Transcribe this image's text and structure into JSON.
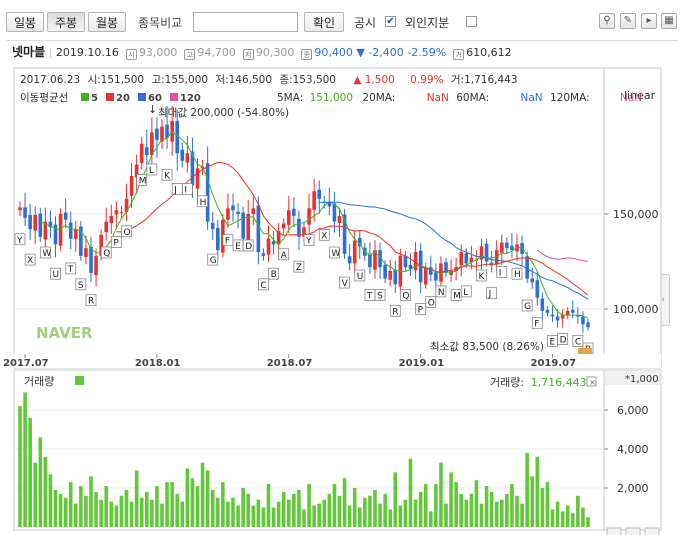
{
  "toolbar": {
    "daily": "일봉",
    "weekly": "주봉",
    "monthly": "월봉",
    "compare_label": "종목비교",
    "confirm": "확인",
    "disclosure": "공시",
    "foreign": "외인지분"
  },
  "header": {
    "name": "넷마블",
    "date": "2019.10.16",
    "open_icon": "시",
    "open": "93,000",
    "high_icon": "고",
    "high": "94,700",
    "low_icon": "저",
    "low": "90,300",
    "close_icon": "종",
    "close": "90,400",
    "change": "▼ -2,400",
    "rate": "-2.59%",
    "volume_icon": "거",
    "volume": "610,612"
  },
  "info_line": {
    "date": "2017.06.23",
    "open": "시:151,500",
    "high": "고:155,000",
    "low": "저:146,500",
    "close": "종:153,500",
    "change": "▲ 1,500",
    "rate": "0.99%",
    "volume": "거:1,716,443"
  },
  "ma_legend": {
    "title": "이동평균선",
    "items": [
      {
        "label": "5",
        "color": "#3cb521"
      },
      {
        "label": "20",
        "color": "#e8322d"
      },
      {
        "label": "60",
        "color": "#2c6fd6"
      },
      {
        "label": "120",
        "color": "#e44fa6"
      }
    ],
    "ma5_label": "5MA:",
    "ma5_value": "151,000",
    "ma20_label": "20MA:",
    "ma20_value": "NaN",
    "ma60_label": "60MA:",
    "ma60_value": "NaN",
    "ma120_label": "120MA:",
    "ma120_value": "NaN"
  },
  "scale_mode": "linear",
  "max_label": "최대값 200,000 (-54.80%)",
  "min_label": "최소값 83,500 (8.26%)",
  "watermark": "NAVER",
  "volume_panel": {
    "title": "거래량",
    "value_label": "거래량:",
    "value": "1,716,443",
    "unit": "*1,000"
  },
  "colors": {
    "up": "#e8322d",
    "down": "#2c6fd6",
    "volume": "#63c73a",
    "ma5": "#3cb521",
    "ma20": "#e8322d",
    "ma60": "#2c6fd6",
    "ma120": "#e44fa6"
  },
  "chart_data": [
    {
      "type": "candlestick",
      "x_ticks": [
        "2017.07",
        "2018.01",
        "2018.07",
        "2019.01",
        "2019.07"
      ],
      "y_ticks": [
        "150,000",
        "100,000"
      ],
      "ylim": [
        80000,
        220000
      ],
      "weekly_close": [
        153500,
        148000,
        142000,
        149500,
        138000,
        146000,
        143000,
        134000,
        150000,
        147000,
        137000,
        142000,
        128000,
        132000,
        119000,
        128000,
        139000,
        146000,
        149000,
        152000,
        151000,
        158000,
        170000,
        176000,
        187000,
        181000,
        193000,
        189000,
        196000,
        190000,
        199000,
        182000,
        178000,
        182000,
        165000,
        174000,
        175000,
        146000,
        142000,
        131000,
        147000,
        153000,
        152000,
        150000,
        137000,
        150000,
        153000,
        130000,
        128000,
        137000,
        134000,
        141000,
        145000,
        152000,
        149000,
        138000,
        143000,
        153000,
        162000,
        158000,
        156000,
        154000,
        146000,
        149000,
        129000,
        124000,
        136000,
        133000,
        128000,
        122000,
        131000,
        122000,
        116000,
        120000,
        113000,
        128000,
        122000,
        121000,
        130000,
        114000,
        122000,
        118000,
        115000,
        124000,
        119000,
        120000,
        122000,
        130000,
        124000,
        127000,
        126000,
        133000,
        125000,
        123000,
        131000,
        135000,
        132000,
        131000,
        134000,
        129000,
        116000,
        114000,
        106000,
        99000,
        98000,
        96000,
        94000,
        97000,
        99000,
        98000,
        96000,
        92000,
        90400
      ],
      "ma20": [
        null,
        null,
        null,
        null,
        null,
        null,
        null,
        null,
        null,
        null,
        null,
        null,
        null,
        null,
        null,
        null,
        null,
        null,
        null,
        140700,
        140600,
        141100,
        142500,
        143800,
        145700,
        147500,
        150400,
        152800,
        155200,
        157100,
        159500,
        162000,
        164500,
        167000,
        169300,
        171600,
        173400,
        174800,
        176100,
        177100,
        176900,
        176100,
        174200,
        171500,
        167700,
        164100,
        160100,
        155100,
        149100,
        145400,
        142800,
        140100,
        138900,
        139000,
        139100,
        139000,
        139000,
        139500,
        140500,
        142400,
        142600,
        143700,
        143600,
        143600,
        143200,
        141800,
        141000,
        141300,
        141100,
        140000,
        139300,
        137800,
        135400,
        133300,
        130000,
        128900,
        127900,
        126300,
        124500,
        122500,
        121200,
        120800,
        119700,
        119500,
        119800,
        120400,
        120700,
        121900,
        122700,
        122700,
        122500,
        123100,
        123600,
        123600,
        123500,
        124500,
        125100,
        125800,
        126600,
        126900,
        126800,
        126400,
        125400,
        124100,
        122200,
        120500,
        118900,
        117300,
        115600,
        113200,
        111500,
        109500,
        107300
      ],
      "ma60": [
        null,
        null,
        null,
        null,
        null,
        null,
        null,
        null,
        null,
        null,
        null,
        null,
        null,
        null,
        null,
        null,
        null,
        null,
        null,
        null,
        null,
        null,
        null,
        null,
        null,
        null,
        null,
        null,
        null,
        null,
        null,
        null,
        null,
        null,
        null,
        null,
        null,
        null,
        null,
        null,
        null,
        null,
        null,
        null,
        null,
        null,
        null,
        null,
        null,
        null,
        null,
        null,
        null,
        null,
        null,
        null,
        null,
        null,
        null,
        156100,
        156200,
        156100,
        156200,
        156200,
        155400,
        154900,
        154700,
        154400,
        154100,
        153700,
        153700,
        153100,
        152600,
        151600,
        150800,
        150100,
        149000,
        148000,
        147500,
        146300,
        144800,
        142700,
        140300,
        137900,
        136100,
        134600,
        132300,
        130900,
        129900,
        128700,
        127700,
        127400,
        126800,
        126000,
        125600,
        125300,
        125100,
        124300,
        123600,
        122700,
        121300,
        119700,
        118300,
        116600,
        115400,
        114900,
        113600,
        112500,
        111300,
        109600,
        108400,
        106800,
        105200
      ],
      "ma120_segment": [
        131000,
        129000,
        127500,
        126600,
        126200,
        126500,
        127000,
        126800,
        126000,
        125500,
        125000
      ],
      "max": {
        "value": 200000,
        "pct": "-54.80%"
      },
      "min": {
        "value": 83500,
        "pct": "8.26%"
      },
      "markers": [
        "Y",
        "X",
        "W",
        "U",
        "T",
        "S",
        "R",
        "Q",
        "P",
        "O",
        "M",
        "L",
        "K",
        "J",
        "I",
        "H",
        "G",
        "F",
        "E",
        "D",
        "C",
        "B",
        "A",
        "Z",
        "Y",
        "X",
        "W",
        "V",
        "U",
        "T",
        "S",
        "R",
        "Q",
        "P",
        "O",
        "N",
        "M",
        "L",
        "K",
        "J",
        "I",
        "H",
        "G",
        "F",
        "E",
        "D",
        "C",
        "B"
      ]
    },
    {
      "type": "bar",
      "title": "거래량",
      "y_ticks": [
        "6,000",
        "4,000",
        "2,000"
      ],
      "ylim": [
        0,
        7200
      ],
      "unit": "*1,000",
      "values": [
        6200,
        6900,
        5600,
        3300,
        4600,
        3600,
        2700,
        1900,
        1700,
        1500,
        2300,
        1200,
        2100,
        1600,
        2600,
        1800,
        1400,
        2100,
        1300,
        1100,
        1600,
        1900,
        1300,
        2900,
        1500,
        1800,
        1400,
        2100,
        1200,
        2300,
        2300,
        1700,
        1300,
        3000,
        2500,
        2100,
        3300,
        2900,
        1900,
        1500,
        2300,
        1300,
        1500,
        1100,
        2000,
        1700,
        1100,
        1400,
        1000,
        2200,
        1000,
        1300,
        1800,
        1400,
        1700,
        1900,
        900,
        2200,
        1100,
        1200,
        1400,
        1700,
        2200,
        1600,
        2500,
        1100,
        2000,
        1000,
        1500,
        1600,
        1900,
        1200,
        1700,
        900,
        2800,
        1100,
        1400,
        3500,
        1400,
        1800,
        2200,
        800,
        2200,
        3300,
        1200,
        2800,
        2300,
        1700,
        1400,
        1700,
        2400,
        1200,
        2100,
        1800,
        1300,
        1400,
        1700,
        2200,
        1600,
        1200,
        3800,
        2600,
        3600,
        2000,
        2300,
        900,
        1300,
        800,
        1100,
        700,
        1600,
        1000,
        500
      ]
    }
  ]
}
